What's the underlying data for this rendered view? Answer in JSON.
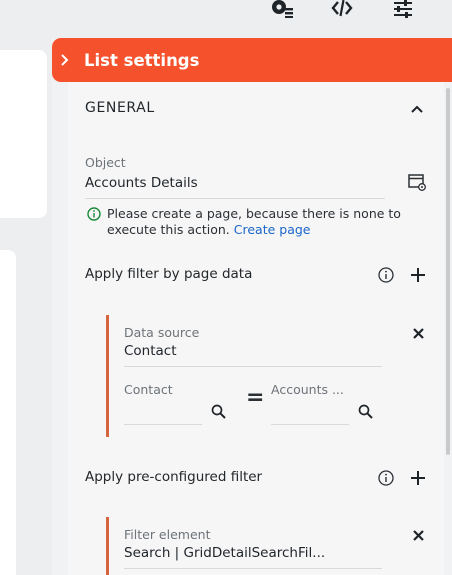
{
  "toolbar": {
    "icons": [
      "settings-gear-icon",
      "code-icon",
      "sliders-icon"
    ]
  },
  "panel": {
    "title": "List settings",
    "accent_color": "#f4512c"
  },
  "general": {
    "title": "GENERAL",
    "object": {
      "label": "Object",
      "value": "Accounts Details"
    },
    "warning": {
      "text": "Please create a page, because there is none to execute this action.",
      "link": "Create page"
    }
  },
  "filter_by_page": {
    "title": "Apply filter by page data",
    "data_source": {
      "label": "Data source",
      "value": "Contact"
    },
    "left_field": {
      "label": "Contact",
      "value": ""
    },
    "operator": "=",
    "right_field": {
      "label": "Accounts ...",
      "value": ""
    }
  },
  "preconfigured": {
    "title": "Apply pre-configured filter",
    "filter_element": {
      "label": "Filter element",
      "value": "Search | GridDetailSearchFil..."
    }
  }
}
